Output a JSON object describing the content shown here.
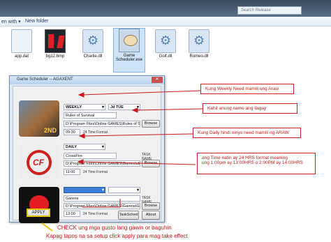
{
  "explorer": {
    "search_placeholder": "Search Release",
    "toolbar": {
      "open_with": "en with ▾",
      "new_folder": "New folder"
    },
    "files": [
      {
        "name": "app.dat",
        "icon": "document-icon"
      },
      {
        "name": "bg12.bmp",
        "icon": "image-icon"
      },
      {
        "name": "Charlie.dll",
        "icon": "gear-file-icon"
      },
      {
        "name": "Game Scheduler.exe",
        "icon": "app-icon"
      },
      {
        "name": "Golf.dll",
        "icon": "gear-file-icon"
      },
      {
        "name": "Romeo.dll",
        "icon": "gear-file-icon"
      }
    ]
  },
  "dialog": {
    "title": "Game Scheduler -- AGAXENT",
    "close": "✕",
    "games": [
      {
        "logo_text": "2ND",
        "frequency": "WEEKLY",
        "day": "Jd TUE",
        "name": "Rules of Survival",
        "path": "D:\\Program Files\\Online GAMES\\Rules of Su",
        "time": "09:30",
        "format": "24 Time Format",
        "browse": "Browse"
      },
      {
        "logo_text": "CF",
        "frequency": "DAILY",
        "task_label": "TASK NAME",
        "name": "CrossFire",
        "path": "D:\\Program Files\\Online GAMES\\Gameclub\\Cr",
        "time": "11:00",
        "format": "24 Time Format",
        "browse": "Browse"
      },
      {
        "frequency": "",
        "task_label": "TASK NAME",
        "name": "Garena",
        "path": "D:\\Program Files\\Online GAMES\\Garena\\Ga",
        "time": "13:00",
        "format": "24 Time Format",
        "browse": "Browse"
      }
    ],
    "apply": "APPLY",
    "tasksched": "TaskSched",
    "about": "About"
  },
  "annotations": {
    "weekly": "Kung Weekly Need mamili ung Araw",
    "name": "Kahit anung name ang ilagay",
    "daily": "Kung Daily hindi ninyo need mamili ng ARAW",
    "time_line1": "ang Time natin ay 24 HRS format meaning",
    "time_line2": "ung 1:00pm ay 13:00HRS o 2:00PM ay 14:00HRS",
    "bottom_line1": "CHECK ung mga gusto lang gawin or baguhin",
    "bottom_line2": "Kapag tapos na sa setup click apply para mag take effect"
  },
  "colors": {
    "annotation": "#c81818",
    "apply_border": "#e8c500",
    "selected_dropdown": "#3d7fd6"
  }
}
